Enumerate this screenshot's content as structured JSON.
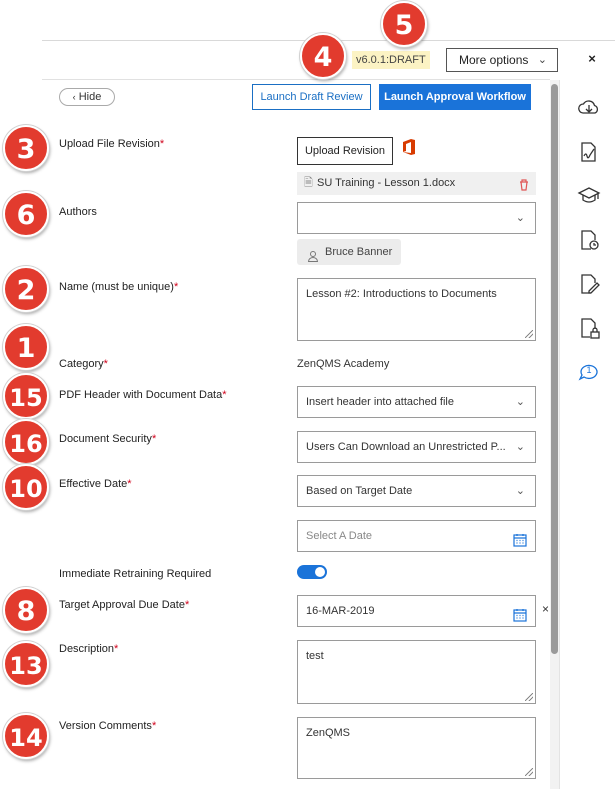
{
  "header": {
    "version": "v6.0.1:DRAFT",
    "more_options": "More options",
    "close": "×"
  },
  "toolbar": {
    "hide": "Hide",
    "launch_draft_review": "Launch Draft Review",
    "launch_approval_workflow": "Launch Approval Workflow"
  },
  "form": {
    "upload": {
      "label": "Upload File Revision",
      "required": "*",
      "button": "Upload Revision",
      "file_name": "SU Training - Lesson 1.docx"
    },
    "authors": {
      "label": "Authors",
      "value": "",
      "chip": "Bruce Banner"
    },
    "name": {
      "label": "Name (must be unique)",
      "required": "*",
      "value": "Lesson #2: Introductions to Documents"
    },
    "category": {
      "label": "Category",
      "required": "*",
      "value": "ZenQMS Academy"
    },
    "pdf_header": {
      "label": "PDF Header with Document Data",
      "required": "*",
      "value": "Insert header into attached file"
    },
    "security": {
      "label": "Document Security",
      "required": "*",
      "value": "Users Can Download an Unrestricted P..."
    },
    "effective_date": {
      "label": "Effective Date",
      "required": "*",
      "value": "Based on Target Date",
      "date_placeholder": "Select A Date"
    },
    "retraining": {
      "label": "Immediate Retraining Required",
      "checked": true
    },
    "target_date": {
      "label": "Target Approval Due Date",
      "required": "*",
      "value": "16-MAR-2019",
      "clear": "×"
    },
    "description": {
      "label": "Description",
      "required": "*",
      "value": "test"
    },
    "version_comments": {
      "label": "Version Comments",
      "required": "*",
      "value": "ZenQMS"
    }
  },
  "badges": {
    "upload": "3",
    "authors": "6",
    "name": "2",
    "category": "1",
    "pdf_header": "15",
    "security": "16",
    "effective_date": "10",
    "target_date": "8",
    "description": "13",
    "version_comments": "14",
    "version": "4",
    "more": "5"
  },
  "sidebar": {
    "icons": [
      "cloud-download-icon",
      "signature-icon",
      "graduation-cap-icon",
      "history-icon",
      "edit-document-icon",
      "lock-document-icon",
      "comment-icon"
    ],
    "comment_count": "1"
  },
  "colors": {
    "accent": "#1a73d9",
    "badge": "#e23b2e",
    "required": "#d0021b",
    "office": "#d83b01"
  }
}
